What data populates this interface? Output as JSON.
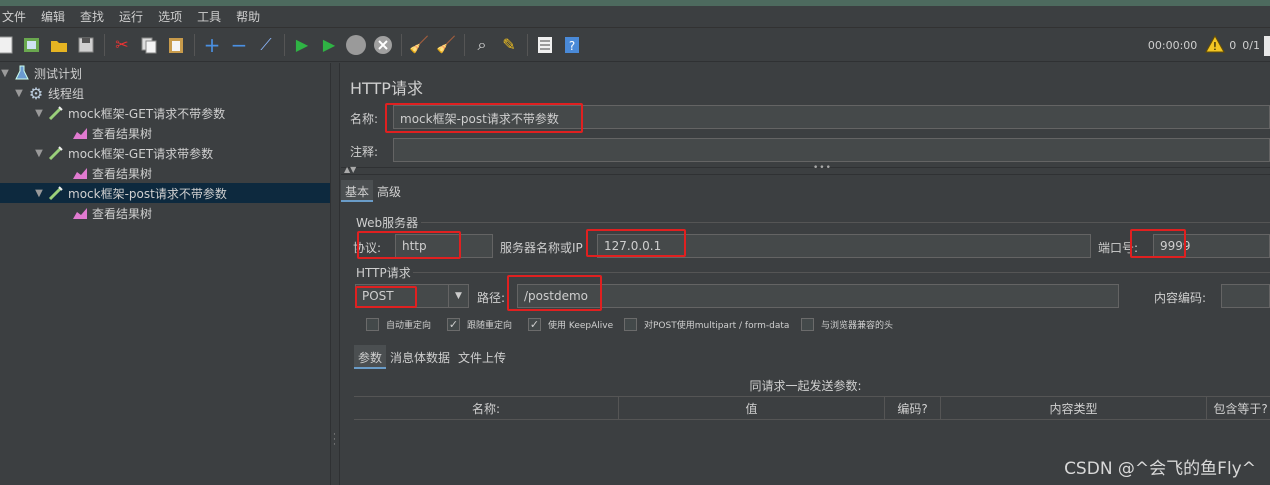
{
  "menu": [
    "文件",
    "编辑",
    "查找",
    "运行",
    "选项",
    "工具",
    "帮助"
  ],
  "toolbar": {
    "icons": [
      "new-icon",
      "templates-icon",
      "open-icon",
      "save-icon",
      "cut-icon",
      "copy-icon",
      "paste-icon",
      "expand-icon",
      "collapse-icon",
      "toggle-icon",
      "start-icon",
      "start-no-pause-icon",
      "stop-icon",
      "shutdown-icon",
      "clear-icon",
      "clear-all-icon",
      "search-icon",
      "reset-search-icon",
      "function-helper-icon",
      "help-icon"
    ],
    "timer": "00:00:00",
    "warning_count": "0",
    "threads": "0/1"
  },
  "tree": {
    "items": [
      {
        "label": "测试计划",
        "icon": "flask-icon"
      },
      {
        "label": "线程组",
        "icon": "gear-icon"
      },
      {
        "label": "mock框架-GET请求不带参数",
        "icon": "pipette-icon"
      },
      {
        "label": "查看结果树",
        "icon": "chart-icon"
      },
      {
        "label": "mock框架-GET请求带参数",
        "icon": "pipette-icon"
      },
      {
        "label": "查看结果树",
        "icon": "chart-icon"
      },
      {
        "label": "mock框架-post请求不带参数",
        "icon": "pipette-icon"
      },
      {
        "label": "查看结果树",
        "icon": "chart-icon"
      }
    ]
  },
  "panel": {
    "title": "HTTP请求",
    "name_label": "名称:",
    "name_value": "mock框架-post请求不带参数",
    "comment_label": "注释:",
    "comment_value": "",
    "tabs": [
      "基本",
      "高级"
    ],
    "web_server_label": "Web服务器",
    "protocol_label": "协议:",
    "protocol_value": "http",
    "server_label": "服务器名称或IP",
    "server_value": "127.0.0.1",
    "port_label": "端口号:",
    "port_value": "9999",
    "http_request_label": "HTTP请求",
    "method_value": "POST",
    "path_label": "路径:",
    "path_value": "/postdemo",
    "encoding_label": "内容编码:",
    "encoding_value": "",
    "checkboxes": [
      {
        "label": "自动重定向",
        "checked": false
      },
      {
        "label": "跟随重定向",
        "checked": true
      },
      {
        "label": "使用 KeepAlive",
        "checked": true
      },
      {
        "label": "对POST使用multipart / form-data",
        "checked": false
      },
      {
        "label": "与浏览器兼容的头",
        "checked": false
      }
    ],
    "sub_tabs": [
      "参数",
      "消息体数据",
      "文件上传"
    ],
    "table_caption": "同请求一起发送参数:",
    "columns": [
      "名称:",
      "值",
      "编码?",
      "内容类型",
      "包含等于?"
    ]
  },
  "watermark": "CSDN @^会飞的鱼Fly^"
}
